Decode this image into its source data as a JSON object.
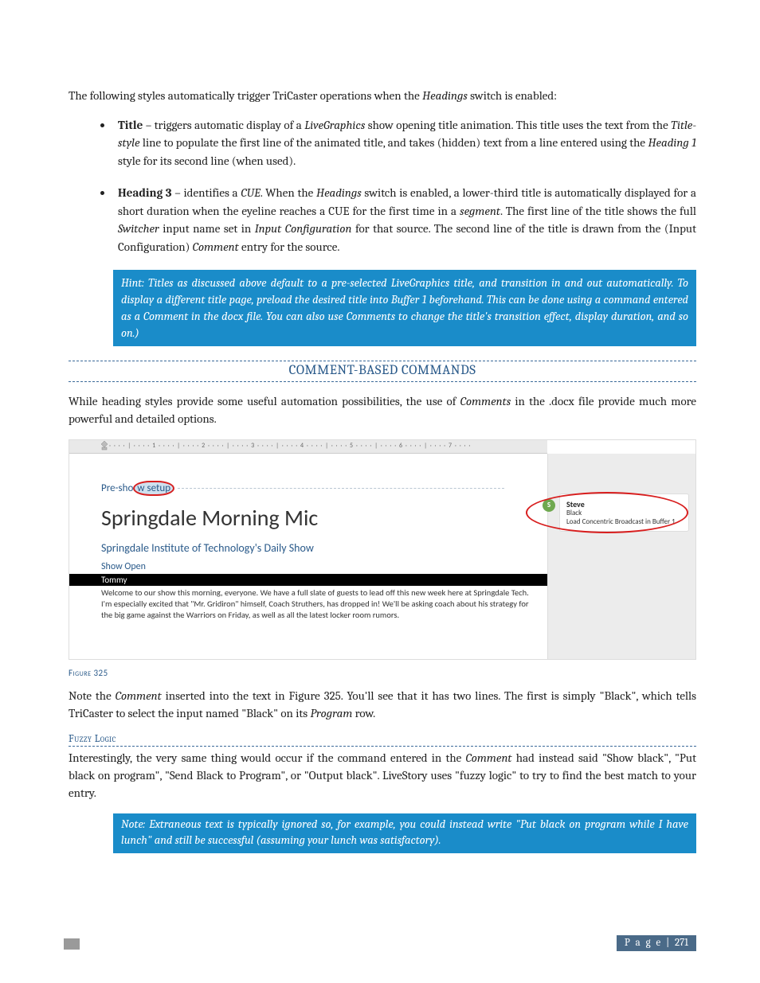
{
  "intro": "The following styles automatically trigger TriCaster operations when the Headings switch is enabled:",
  "bullets": {
    "b1_label": "Title",
    "b1_rest": " – triggers automatic display of a LiveGraphics show opening title animation.  This title uses the text from the Title-style line to populate the first line of the animated title, and takes (hidden) text from a line entered using the Heading 1 style for its second line (when used).",
    "b2_label": "Heading 3",
    "b2_rest": " – identifies a CUE.  When the Headings switch is enabled, a lower-third title is automatically displayed for a short duration when the eyeline reaches a CUE for the first time in a segment.  The first line of the title shows the full Switcher input name set in Input Configuration for that source.  The second line of the title is drawn from the (Input Configuration) Comment entry for the source."
  },
  "hint": "Hint: Titles as discussed above default to a pre-selected LiveGraphics title, and transition in and out automatically.  To display a different title page, preload the desired title into Buffer 1 beforehand.  This can be done using a command entered as a Comment in the docx file.  You can also use Comments to change the title's transition effect, display duration, and so on.)",
  "section_heading": "COMMENT-BASED COMMANDS",
  "para_after_section": "While heading styles provide some useful automation possibilities, the use of Comments in the .docx file provide much more powerful and detailed options.",
  "figure": {
    "ruler_ticks": "· · · · | · · · · 1 · · · · | · · · · 2 · · · · | · · · · 3 · · · · | · · · · 4 · · · · | · · · · 5 · · · · | · · · · 6 · · · · | · · · · 7 · · · ·",
    "pre_line_prefix": "Pre-sho",
    "pre_line_circled": "w setup",
    "doc_title": "Springdale Morning Mic",
    "doc_sub": "Springdale Institute of Technology's Daily Show",
    "doc_open": "Show Open",
    "speaker": "Tommy",
    "script": "Welcome to our show this morning, everyone.  We have a full slate of guests to lead off this new week here at Springdale Tech.  I'm especially excited that \"Mr. Gridiron\" himself, Coach Struthers, has dropped in!  We'll be asking coach about his strategy for the big game against the Warriors on Friday, as well as all the latest locker room rumors.",
    "comment_initial": "S",
    "comment_author": "Steve",
    "comment_line1": "Black",
    "comment_line2": "Load Concentric Broadcast in Buffer 1"
  },
  "figure_caption": "Figure 325",
  "para_note": "Note the Comment inserted into the text in Figure 325.  You'll see that it has two lines.  The first is simply \"Black\", which tells TriCaster to select the input named \"Black\" on its Program row.",
  "subhead": "Fuzzy Logic",
  "para_fuzzy": "Interestingly, the very same thing would occur if the command entered in the Comment had instead said \"Show black\", \"Put black on program\", \"Send Black to Program\", or \"Output black\".  LiveStory uses \"fuzzy logic\" to try to find the best match to your entry.",
  "note": "Note: Extraneous text is typically ignored so, for example, you could instead write \"Put black on program while I have lunch\" and still be successful (assuming your lunch was satisfactory).",
  "footer_label": "P a g e",
  "footer_sep": " | ",
  "footer_num": "271"
}
